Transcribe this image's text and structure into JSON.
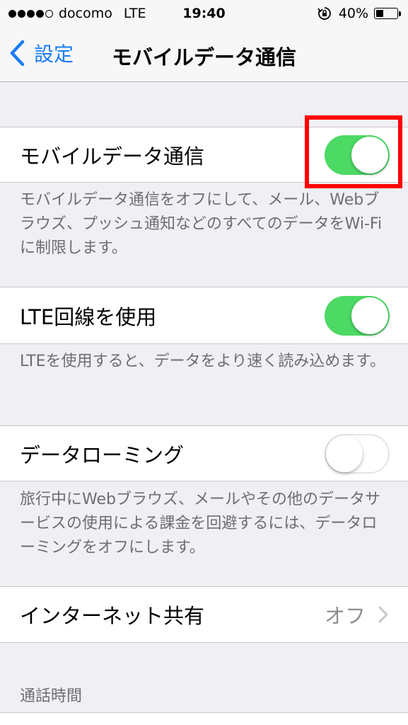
{
  "status_bar": {
    "signal_filled": 4,
    "signal_total": 5,
    "carrier": "docomo",
    "network": "LTE",
    "time": "19:40",
    "battery_percent": "40%",
    "battery_level": 0.4,
    "rotation_lock_icon": "rotation-lock-icon"
  },
  "nav": {
    "back_label": "設定",
    "title": "モバイルデータ通信"
  },
  "settings": [
    {
      "label": "モバイルデータ通信",
      "toggle_on": true,
      "footer": "モバイルデータ通信をオフにして、メール、Webブラウズ、プッシュ通知などのすべてのデータをWi-Fiに制限します。"
    },
    {
      "label": "LTE回線を使用",
      "toggle_on": true,
      "footer": "LTEを使用すると、データをより速く読み込めます。"
    },
    {
      "label": "データローミング",
      "toggle_on": false,
      "footer": "旅行中にWebブラウズ、メールやその他のデータサービスの使用による課金を回避するには、データローミングをオフにします。"
    }
  ],
  "tethering": {
    "label": "インターネット共有",
    "value": "オフ"
  },
  "call_time_header": "通話時間",
  "colors": {
    "accent": "#1a7cf4",
    "toggle_on": "#4cd964",
    "highlight": "#ff0000",
    "background": "#efeff4"
  }
}
